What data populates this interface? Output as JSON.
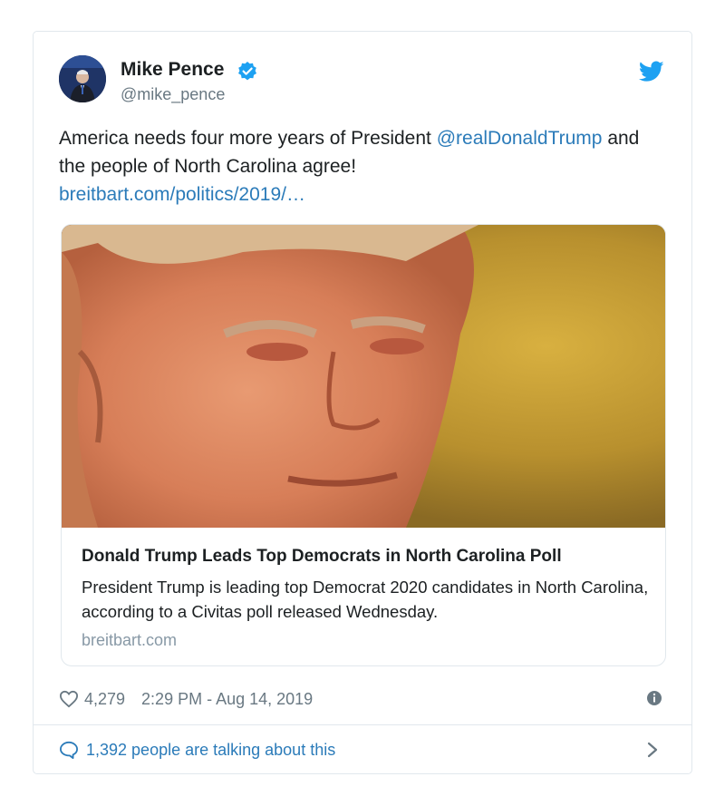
{
  "author": {
    "name": "Mike Pence",
    "handle": "@mike_pence"
  },
  "tweet": {
    "text_before": "America needs four more years of President ",
    "mention": "@realDonaldTrump",
    "text_after": " and the people of North Carolina agree!",
    "link": "breitbart.com/politics/2019/…"
  },
  "preview": {
    "image": "photo-donald-trump",
    "title": "Donald Trump Leads Top Democrats in North Carolina Poll",
    "description": "President Trump is leading top Democrat 2020 candidates in North Carolina, according to a Civitas poll released Wednesday.",
    "domain": "breitbart.com"
  },
  "meta": {
    "likes": "4,279",
    "timestamp": "2:29 PM - Aug 14, 2019"
  },
  "conversation": {
    "text": "1,392 people are talking about this"
  },
  "colors": {
    "accent": "#1da1f2",
    "link": "#2b7bb9",
    "muted": "#697882",
    "border": "#e1e8ed"
  },
  "icons": [
    "verified-icon",
    "twitter-logo-icon",
    "heart-icon",
    "info-icon",
    "comment-icon",
    "chevron-right-icon"
  ]
}
